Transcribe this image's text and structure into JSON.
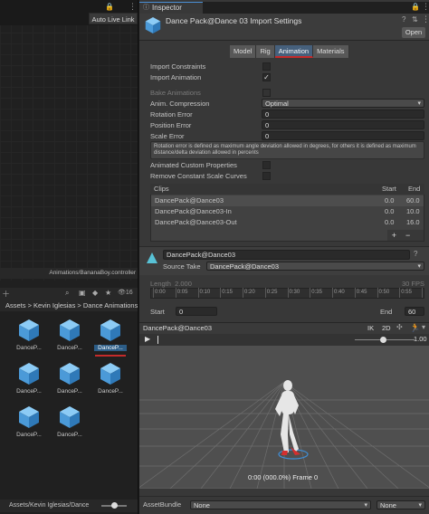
{
  "left": {
    "auto_live_link": "Auto Live Link",
    "animator_path": "Animations/BananaBoy.controller",
    "asset_count": "16",
    "breadcrumb": "Assets > Kevin Iglesias > Dance Animations",
    "assets": [
      {
        "label": "DanceP...",
        "selected": false
      },
      {
        "label": "DanceP...",
        "selected": false
      },
      {
        "label": "DanceP...",
        "selected": true
      },
      {
        "label": "DanceP...",
        "selected": false
      },
      {
        "label": "DanceP...",
        "selected": false
      },
      {
        "label": "DanceP...",
        "selected": false
      },
      {
        "label": "DanceP...",
        "selected": false
      },
      {
        "label": "DanceP...",
        "selected": false
      }
    ],
    "path_bar": "Assets/Kevin Iglesias/Dance"
  },
  "inspector": {
    "tab_label": "Inspector",
    "title": "Dance Pack@Dance 03 Import Settings",
    "open_label": "Open",
    "tabs": [
      {
        "label": "Model",
        "active": false
      },
      {
        "label": "Rig",
        "active": false
      },
      {
        "label": "Animation",
        "active": true
      },
      {
        "label": "Materials",
        "active": false
      }
    ],
    "import_constraints_label": "Import Constraints",
    "import_constraints_checked": false,
    "import_animation_label": "Import Animation",
    "import_animation_checked": true,
    "bake_animations_label": "Bake Animations",
    "anim_compression_label": "Anim. Compression",
    "anim_compression_value": "Optimal",
    "rotation_error_label": "Rotation Error",
    "rotation_error_value": "0",
    "position_error_label": "Position Error",
    "position_error_value": "0",
    "scale_error_label": "Scale Error",
    "scale_error_value": "0",
    "help_text": "Rotation error is defined as maximum angle deviation allowed in degrees, for others it is defined as maximum distance/delta deviation allowed in percents",
    "animated_custom_properties_label": "Animated Custom Properties",
    "remove_constant_scale_curves_label": "Remove Constant Scale Curves",
    "clips": {
      "header": "Clips",
      "start_header": "Start",
      "end_header": "End",
      "rows": [
        {
          "name": "DancePack@Dance03",
          "start": "0.0",
          "end": "60.0",
          "selected": true
        },
        {
          "name": "DancePack@Dance03-In",
          "start": "0.0",
          "end": "10.0",
          "selected": false
        },
        {
          "name": "DancePack@Dance03-Out",
          "start": "0.0",
          "end": "16.0",
          "selected": false
        }
      ],
      "plus": "+",
      "minus": "−"
    },
    "clip_name": "DancePack@Dance03",
    "source_take_label": "Source Take",
    "source_take_value": "DancePack@Dance03",
    "length_label": "Length",
    "length_value": "2.000",
    "fps": "30 FPS",
    "timeline_ticks": [
      "0:00",
      "0:05",
      "0:10",
      "0:15",
      "0:20",
      "0:25",
      "0:30",
      "0:35",
      "0:40",
      "0:45",
      "0:50",
      "0:55",
      "1:00"
    ],
    "start_label": "Start",
    "start_value": "0",
    "end_label": "End",
    "end_value": "60",
    "preview_title": "DancePack@Dance03",
    "preview_ik": "IK",
    "preview_2d": "2D",
    "preview_speed": "1.00",
    "preview_status": "0:00 (000.0%) Frame 0",
    "asset_bundle_label": "AssetBundle",
    "asset_bundle_value": "None",
    "asset_bundle_variant": "None"
  },
  "colors": {
    "accent_blue": "#46607c",
    "highlight_red": "#c42b2b",
    "selection_blue": "#2c5d87",
    "cube_blue": "#5aa9e6"
  }
}
